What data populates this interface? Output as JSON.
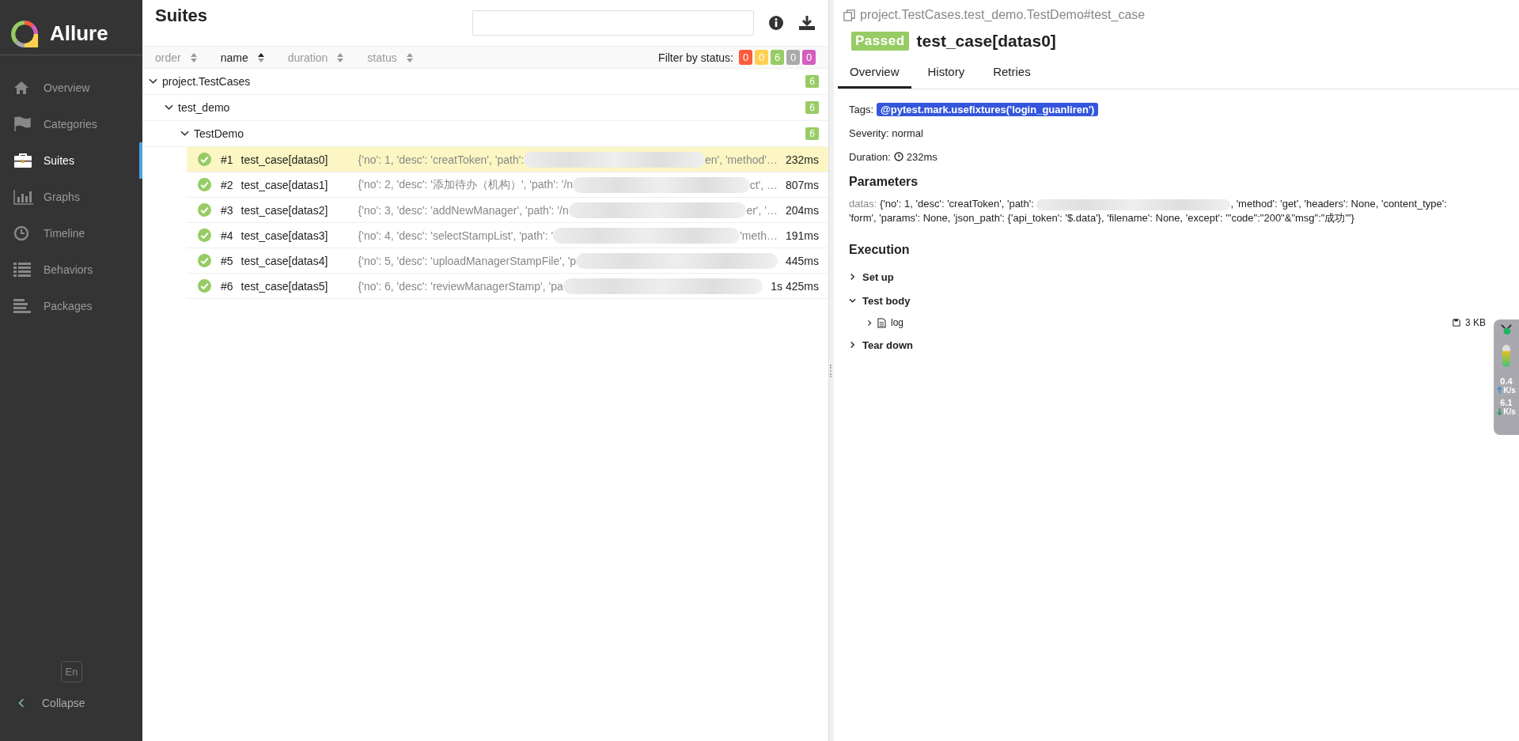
{
  "sidebar": {
    "logo_text": "Allure",
    "items": [
      {
        "label": "Overview",
        "selected": false
      },
      {
        "label": "Categories",
        "selected": false
      },
      {
        "label": "Suites",
        "selected": true
      },
      {
        "label": "Graphs",
        "selected": false
      },
      {
        "label": "Timeline",
        "selected": false
      },
      {
        "label": "Behaviors",
        "selected": false
      },
      {
        "label": "Packages",
        "selected": false
      }
    ],
    "language": "En",
    "collapse": "Collapse"
  },
  "suites": {
    "title": "Suites",
    "sort_columns": [
      {
        "label": "order",
        "selected": false
      },
      {
        "label": "name",
        "selected": true
      },
      {
        "label": "duration",
        "selected": false
      },
      {
        "label": "status",
        "selected": false
      }
    ],
    "filter": {
      "label": "Filter by status:",
      "counts": [
        {
          "value": "0",
          "color": "#fd5a3e"
        },
        {
          "value": "0",
          "color": "#ffd050"
        },
        {
          "value": "6",
          "color": "#97cc64"
        },
        {
          "value": "0",
          "color": "#aaaaaa"
        },
        {
          "value": "0",
          "color": "#d35ebe"
        }
      ]
    },
    "tree": [
      {
        "kind": "group",
        "name": "project.TestCases",
        "count": "6",
        "expanded": true,
        "children": [
          {
            "kind": "group",
            "name": "test_demo",
            "count": "6",
            "expanded": true,
            "children": [
              {
                "kind": "group",
                "name": "TestDemo",
                "count": "6",
                "expanded": true,
                "children": [
                  {
                    "kind": "test",
                    "selected": true,
                    "number": "#1",
                    "name": "test_case[datas0]",
                    "params_before": "{'no': 1, 'desc': 'creatToken', 'path': ",
                    "params_after": "en', 'method'…",
                    "duration": "232ms"
                  },
                  {
                    "kind": "test",
                    "selected": false,
                    "number": "#2",
                    "name": "test_case[datas1]",
                    "params_before": "{'no': 2, 'desc': '添加待办（机构）', 'path': '/n",
                    "params_after": "ct', …",
                    "duration": "807ms"
                  },
                  {
                    "kind": "test",
                    "selected": false,
                    "number": "#3",
                    "name": "test_case[datas2]",
                    "params_before": "{'no': 3, 'desc': 'addNewManager', 'path': '/n",
                    "params_after": "er', '…",
                    "duration": "204ms"
                  },
                  {
                    "kind": "test",
                    "selected": false,
                    "number": "#4",
                    "name": "test_case[datas3]",
                    "params_before": "{'no': 4, 'desc': 'selectStampList', 'path': '",
                    "params_after": "'meth…",
                    "duration": "191ms"
                  },
                  {
                    "kind": "test",
                    "selected": false,
                    "number": "#5",
                    "name": "test_case[datas4]",
                    "params_before": "{'no': 5, 'desc': 'uploadManagerStampFile', 'p",
                    "duration": "445ms"
                  },
                  {
                    "kind": "test",
                    "selected": false,
                    "number": "#6",
                    "name": "test_case[datas5]",
                    "params_before": "{'no': 6, 'desc': 'reviewManagerStamp', 'pa",
                    "duration": "1s 425ms"
                  }
                ]
              }
            ]
          }
        ]
      }
    ]
  },
  "details": {
    "path": "project.TestCases.test_demo.TestDemo#test_case",
    "status": "Passed",
    "title": "test_case[datas0]",
    "tabs": [
      {
        "label": "Overview",
        "selected": true
      },
      {
        "label": "History",
        "selected": false
      },
      {
        "label": "Retries",
        "selected": false
      }
    ],
    "tags_label": "Tags:",
    "tags": [
      "@pytest.mark.usefixtures('login_guanliren')"
    ],
    "severity": "Severity: normal",
    "duration_label": "Duration:",
    "duration": "232ms",
    "parameters_heading": "Parameters",
    "parameter": {
      "name": "datas:",
      "before": "{'no': 1, 'desc': 'creatToken', 'path': ",
      "after": ", 'method': 'get', 'headers': None, 'content_type':",
      "continuation": "'form', 'params': None, 'json_path': {'api_token': '$.data'}, 'filename': None, 'except': '\"code\":\"200\"&\"msg\":\"成功\"'}"
    },
    "execution_heading": "Execution",
    "steps": [
      {
        "label": "Set up",
        "expanded": false
      },
      {
        "label": "Test body",
        "expanded": true,
        "attachments": [
          {
            "name": "log",
            "size": "3 KB",
            "expanded": false
          }
        ]
      },
      {
        "label": "Tear down",
        "expanded": false
      }
    ]
  },
  "network_widget": {
    "upload": "0.4",
    "upload_unit": "K/s",
    "download": "6.1",
    "download_unit": "K/s"
  }
}
